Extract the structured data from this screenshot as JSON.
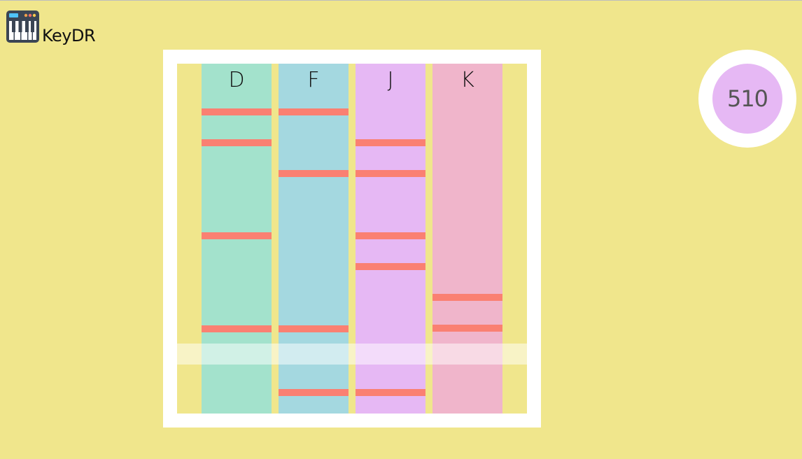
{
  "app": {
    "name": "KeyDR",
    "logo_icon": "piano-keyboard-icon"
  },
  "colors": {
    "background": "#f0e68c",
    "frame": "#ffffff",
    "note": "#fa8072",
    "score_fill": "#e6b8f4"
  },
  "game": {
    "lanes": [
      {
        "key": "D",
        "color": "#a3e2cc",
        "notes": [
          64,
          108,
          241,
          374
        ]
      },
      {
        "key": "F",
        "color": "#a4d8e0",
        "notes": [
          64,
          152,
          374,
          465
        ]
      },
      {
        "key": "J",
        "color": "#e6b8f4",
        "notes": [
          108,
          152,
          241,
          285,
          465
        ]
      },
      {
        "key": "K",
        "color": "#f0b5cb",
        "notes": [
          329,
          373
        ]
      }
    ]
  },
  "score": {
    "value": "510"
  }
}
